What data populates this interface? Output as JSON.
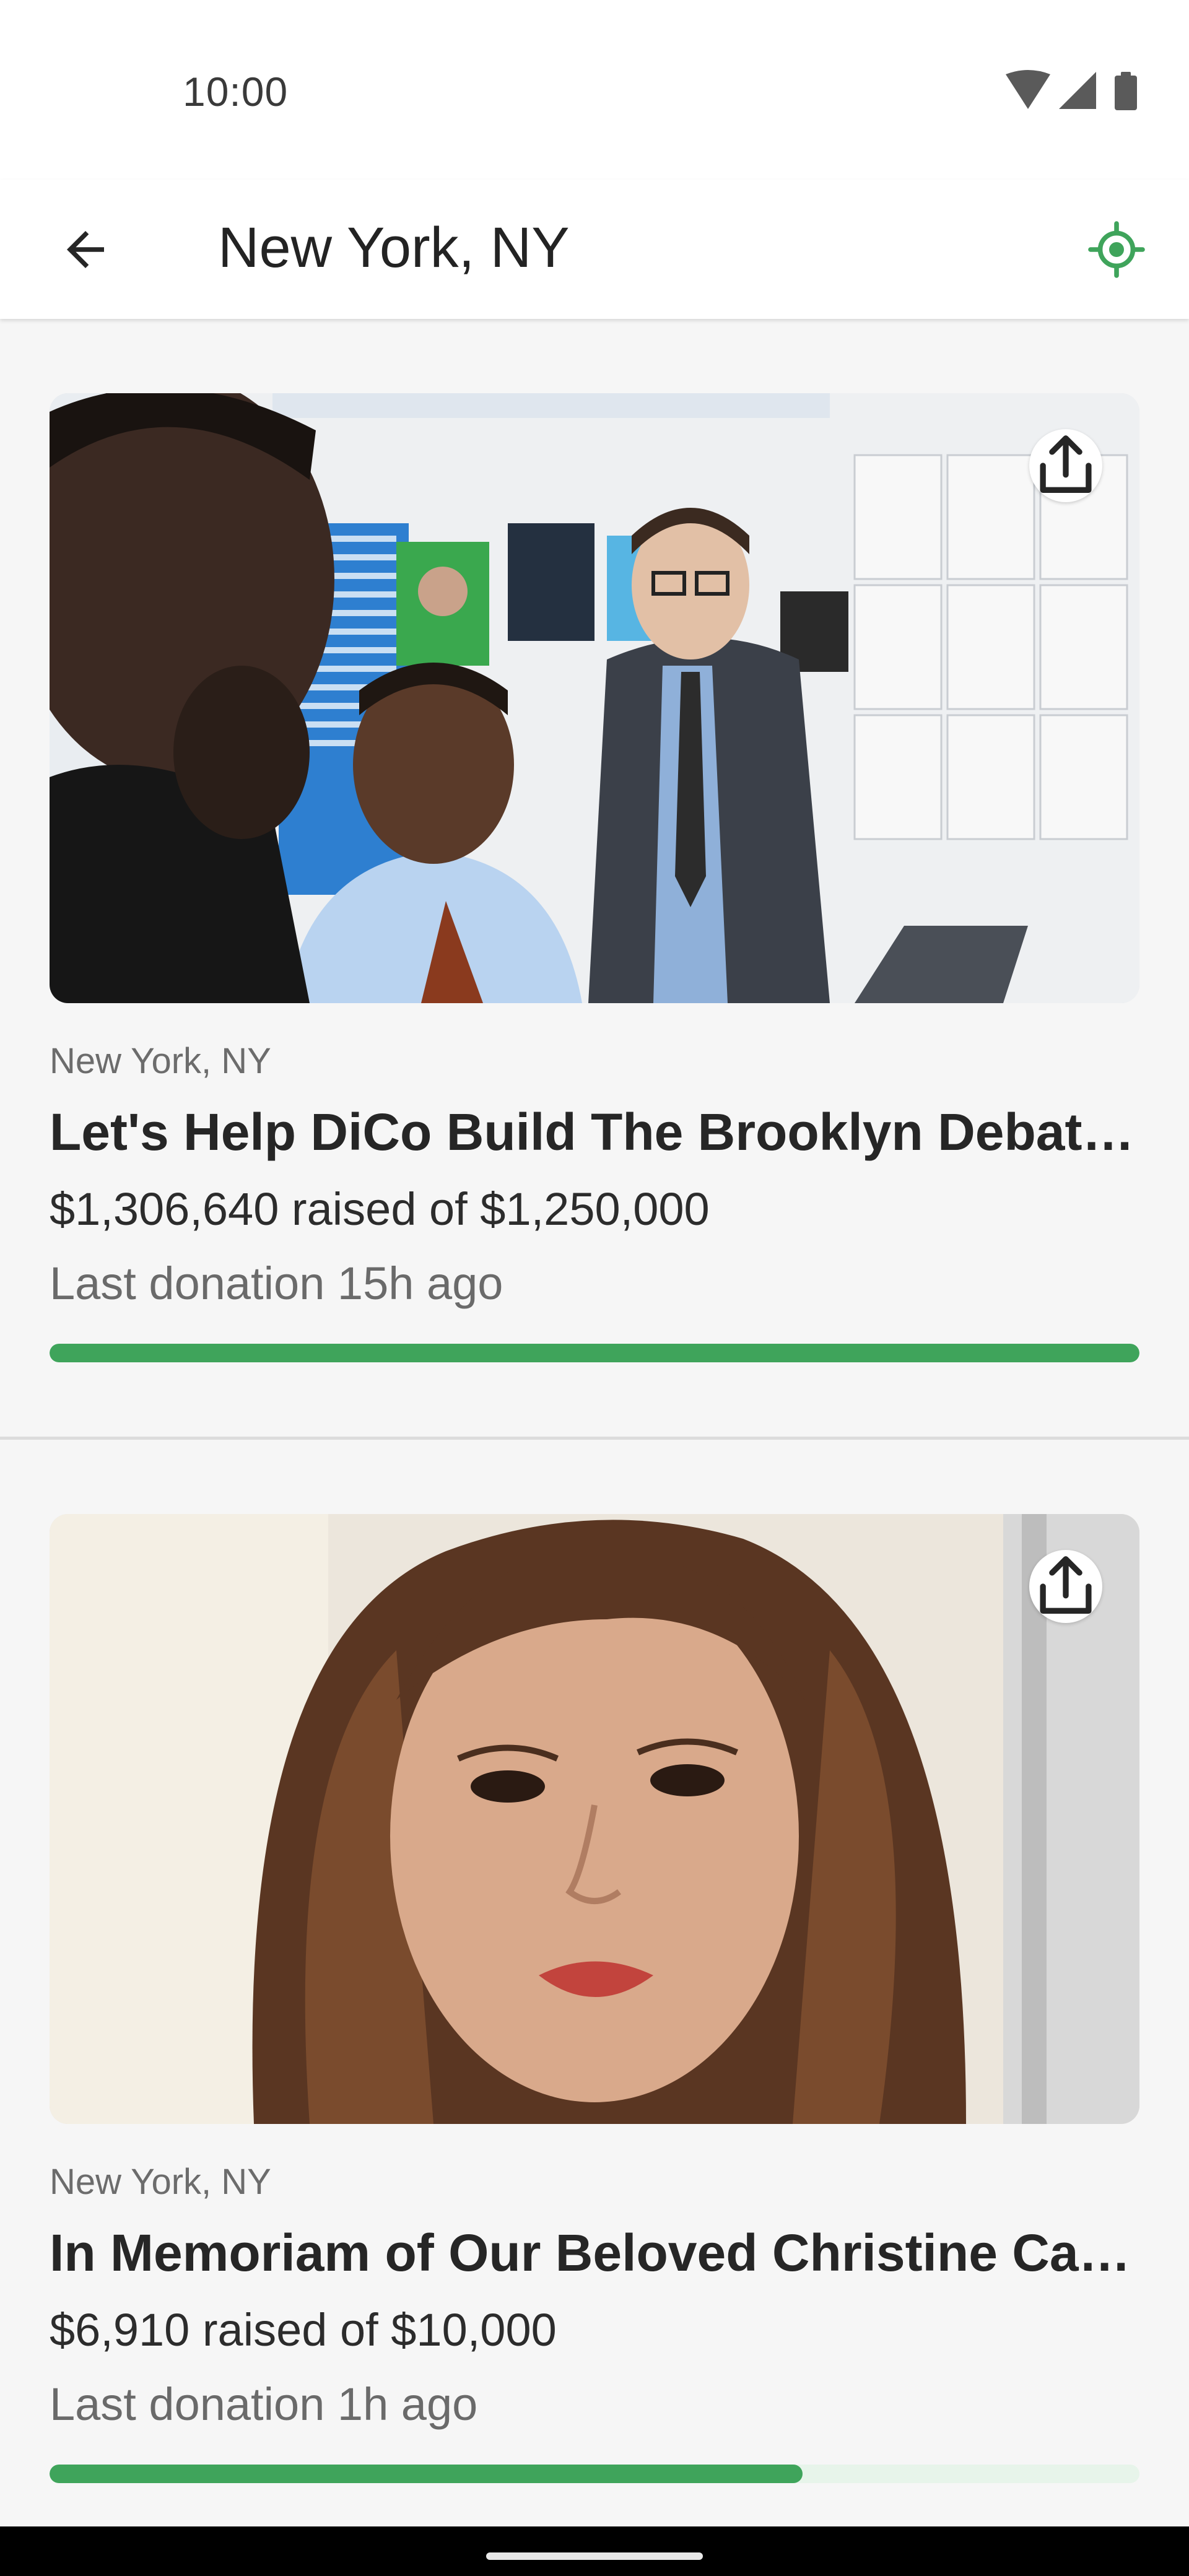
{
  "status_bar": {
    "time": "10:00"
  },
  "app_bar": {
    "title": "New York, NY",
    "back_icon": "arrow-back-icon",
    "locate_icon": "my-location-icon"
  },
  "colors": {
    "accent_green": "#3fa45b",
    "progress_track": "#e7f4ea"
  },
  "fundraisers": [
    {
      "location": "New York, NY",
      "title": "Let's Help DiCo Build The Brooklyn Debate Center",
      "raised": "$1,306,640 raised of $1,250,000",
      "last_donation": "Last donation 15h ago",
      "progress": 1.0,
      "image": "classroom-photo"
    },
    {
      "location": "New York, NY",
      "title": "In Memoriam of Our Beloved Christine Castillo",
      "raised": "$6,910 raised of $10,000",
      "last_donation": "Last donation 1h ago",
      "progress": 0.691,
      "image": "portrait-photo"
    }
  ]
}
